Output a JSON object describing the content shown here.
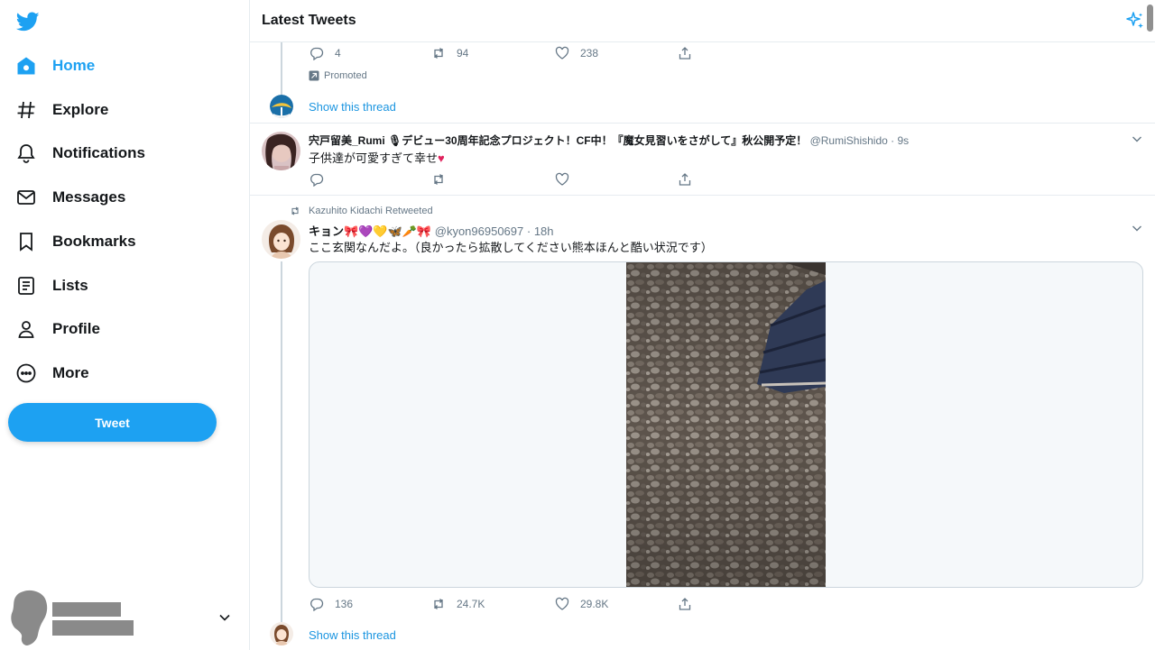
{
  "sidebar": {
    "logo": "twitter-bird-icon",
    "items": [
      {
        "label": "Home",
        "icon": "home-icon",
        "active": true
      },
      {
        "label": "Explore",
        "icon": "hashtag-icon"
      },
      {
        "label": "Notifications",
        "icon": "bell-icon"
      },
      {
        "label": "Messages",
        "icon": "envelope-icon"
      },
      {
        "label": "Bookmarks",
        "icon": "bookmark-icon"
      },
      {
        "label": "Lists",
        "icon": "list-icon"
      },
      {
        "label": "Profile",
        "icon": "person-icon"
      },
      {
        "label": "More",
        "icon": "more-circle-icon"
      }
    ],
    "tweet_button": "Tweet"
  },
  "header": {
    "title": "Latest Tweets",
    "icon": "sparkle-icon"
  },
  "colors": {
    "accent": "#1da1f2",
    "link": "#1b95e0",
    "muted": "#657786",
    "border": "#e6ecf0",
    "heart": "#e0245e"
  },
  "promoted_tweet": {
    "actions": {
      "reply": "4",
      "retweet": "94",
      "like": "238"
    },
    "promoted_label": "Promoted",
    "show_thread": "Show this thread"
  },
  "tweet1": {
    "name": "宍戸留美_Rumi 🎙デビュー30周年記念プロジェクト！CF中！『魔女見習いをさがして』秋公開予定！",
    "handle": "@RumiShishido",
    "time": "· 9s",
    "text": "子供達が可愛すぎて幸せ",
    "emoji": "♥",
    "actions": {
      "reply": "",
      "retweet": "",
      "like": ""
    }
  },
  "tweet2": {
    "retweeted_by": "Kazuhito Kidachi Retweeted",
    "name": "キョン🎀💜💛🦋🥕🎀",
    "handle": "@kyon96950697",
    "time": "· 18h",
    "text": "ここ玄関なんだよ。（良かったら拡散してください熊本ほんと酷い状況です）",
    "actions": {
      "reply": "136",
      "retweet": "24.7K",
      "like": "29.8K"
    },
    "show_thread": "Show this thread"
  }
}
